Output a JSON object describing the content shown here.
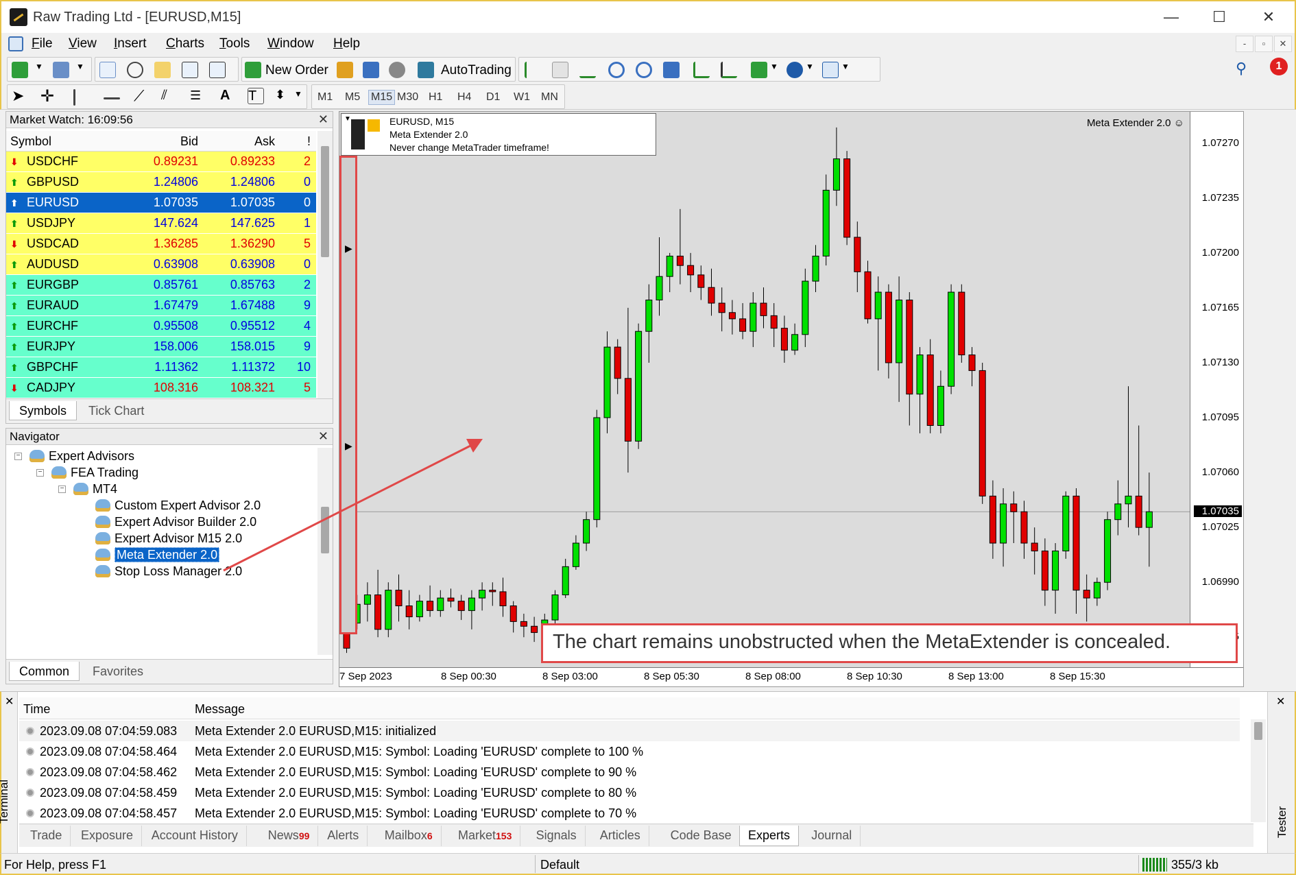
{
  "window": {
    "title": "Raw Trading Ltd - [EURUSD,M15]",
    "minimize": "—",
    "maximize": "☐",
    "close": "✕"
  },
  "menu": [
    "File",
    "View",
    "Insert",
    "Charts",
    "Tools",
    "Window",
    "Help"
  ],
  "mdi": [
    "-",
    "▫",
    "✕"
  ],
  "toolbar": {
    "new_order": "New Order",
    "autotrading": "AutoTrading",
    "notification_count": "1",
    "timeframes": [
      "M1",
      "M5",
      "M15",
      "M30",
      "H1",
      "H4",
      "D1",
      "W1",
      "MN"
    ],
    "selected_timeframe": "M15"
  },
  "market_watch": {
    "title": "Market Watch: 16:09:56",
    "columns": [
      "Symbol",
      "Bid",
      "Ask",
      "!"
    ],
    "rows": [
      {
        "symbol": "USDCHF",
        "bid": "0.89231",
        "ask": "0.89233",
        "count": "2",
        "dir": "down",
        "bg": "yellow"
      },
      {
        "symbol": "GBPUSD",
        "bid": "1.24806",
        "ask": "1.24806",
        "count": "0",
        "dir": "up",
        "bg": "yellow"
      },
      {
        "symbol": "EURUSD",
        "bid": "1.07035",
        "ask": "1.07035",
        "count": "0",
        "dir": "up",
        "bg": "selected"
      },
      {
        "symbol": "USDJPY",
        "bid": "147.624",
        "ask": "147.625",
        "count": "1",
        "dir": "up",
        "bg": "yellow"
      },
      {
        "symbol": "USDCAD",
        "bid": "1.36285",
        "ask": "1.36290",
        "count": "5",
        "dir": "down",
        "bg": "yellow"
      },
      {
        "symbol": "AUDUSD",
        "bid": "0.63908",
        "ask": "0.63908",
        "count": "0",
        "dir": "up",
        "bg": "yellow"
      },
      {
        "symbol": "EURGBP",
        "bid": "0.85761",
        "ask": "0.85763",
        "count": "2",
        "dir": "up",
        "bg": "cyan"
      },
      {
        "symbol": "EURAUD",
        "bid": "1.67479",
        "ask": "1.67488",
        "count": "9",
        "dir": "up",
        "bg": "cyan"
      },
      {
        "symbol": "EURCHF",
        "bid": "0.95508",
        "ask": "0.95512",
        "count": "4",
        "dir": "up",
        "bg": "cyan"
      },
      {
        "symbol": "EURJPY",
        "bid": "158.006",
        "ask": "158.015",
        "count": "9",
        "dir": "up",
        "bg": "cyan"
      },
      {
        "symbol": "GBPCHF",
        "bid": "1.11362",
        "ask": "1.11372",
        "count": "10",
        "dir": "up",
        "bg": "cyan"
      },
      {
        "symbol": "CADJPY",
        "bid": "108.316",
        "ask": "108.321",
        "count": "5",
        "dir": "down",
        "bg": "cyan"
      }
    ],
    "tabs": [
      "Symbols",
      "Tick Chart"
    ]
  },
  "navigator": {
    "title": "Navigator",
    "nodes": [
      "Expert Advisors",
      "FEA Trading",
      "MT4",
      "Custom Expert Advisor 2.0",
      "Expert Advisor Builder 2.0",
      "Expert Advisor M15 2.0",
      "Meta Extender 2.0",
      "Stop Loss Manager 2.0"
    ],
    "selected": "Meta Extender 2.0",
    "tabs": [
      "Common",
      "Favorites"
    ]
  },
  "chart": {
    "info_lines": [
      "EURUSD, M15",
      "Meta Extender 2.0",
      "Never change MetaTrader timeframe!"
    ],
    "ea_label": "Meta Extender 2.0 ☺",
    "callout": "The chart remains unobstructed when the MetaExtender is concealed.",
    "price_ticks": [
      "1.07270",
      "1.07235",
      "1.07200",
      "1.07165",
      "1.07130",
      "1.07095",
      "1.07060",
      "1.07025",
      "1.06990",
      "1.06955"
    ],
    "current_price": "1.07035",
    "time_ticks": [
      "7 Sep 2023",
      "8 Sep 00:30",
      "8 Sep 03:00",
      "8 Sep 05:30",
      "8 Sep 08:00",
      "8 Sep 10:30",
      "8 Sep 13:00",
      "8 Sep 15:30"
    ]
  },
  "chart_data": {
    "type": "candlestick",
    "symbol": "EURUSD",
    "timeframe": "M15",
    "ylim": [
      1.06935,
      1.0729
    ],
    "x_tick_labels": [
      "7 Sep 2023",
      "8 Sep 00:30",
      "8 Sep 03:00",
      "8 Sep 05:30",
      "8 Sep 08:00",
      "8 Sep 10:30",
      "8 Sep 13:00",
      "8 Sep 15:30"
    ],
    "y_tick_labels": [
      "1.07270",
      "1.07235",
      "1.07200",
      "1.07165",
      "1.07130",
      "1.07095",
      "1.07060",
      "1.07025",
      "1.06990",
      "1.06955"
    ],
    "last_price": 1.07035,
    "candles": [
      [
        1.06962,
        1.06973,
        1.06945,
        1.06948
      ],
      [
        1.06964,
        1.06982,
        1.0696,
        1.06976
      ],
      [
        1.06976,
        1.0699,
        1.06965,
        1.06982
      ],
      [
        1.06982,
        1.06998,
        1.06955,
        1.0696
      ],
      [
        1.0696,
        1.0699,
        1.06955,
        1.06985
      ],
      [
        1.06985,
        1.06995,
        1.06965,
        1.06975
      ],
      [
        1.06975,
        1.06985,
        1.0696,
        1.06968
      ],
      [
        1.06968,
        1.06982,
        1.06965,
        1.06978
      ],
      [
        1.06978,
        1.06988,
        1.06968,
        1.06972
      ],
      [
        1.06972,
        1.06985,
        1.06968,
        1.0698
      ],
      [
        1.0698,
        1.06986,
        1.06974,
        1.06978
      ],
      [
        1.06978,
        1.06982,
        1.06966,
        1.06972
      ],
      [
        1.06972,
        1.06985,
        1.0696,
        1.0698
      ],
      [
        1.0698,
        1.0699,
        1.06972,
        1.06985
      ],
      [
        1.06985,
        1.0699,
        1.06975,
        1.06984
      ],
      [
        1.06984,
        1.06993,
        1.06968,
        1.06975
      ],
      [
        1.06975,
        1.06978,
        1.06958,
        1.06965
      ],
      [
        1.06965,
        1.0697,
        1.06955,
        1.06962
      ],
      [
        1.06962,
        1.06968,
        1.06952,
        1.06958
      ],
      [
        1.06958,
        1.0697,
        1.06955,
        1.06966
      ],
      [
        1.06966,
        1.06985,
        1.0696,
        1.06982
      ],
      [
        1.06982,
        1.07005,
        1.0698,
        1.07
      ],
      [
        1.07,
        1.0702,
        1.06998,
        1.07015
      ],
      [
        1.07015,
        1.07035,
        1.0701,
        1.0703
      ],
      [
        1.0703,
        1.071,
        1.07025,
        1.07095
      ],
      [
        1.07095,
        1.0715,
        1.07085,
        1.0714
      ],
      [
        1.0714,
        1.07145,
        1.0711,
        1.0712
      ],
      [
        1.0712,
        1.07165,
        1.0706,
        1.0708
      ],
      [
        1.0708,
        1.07155,
        1.07075,
        1.0715
      ],
      [
        1.0715,
        1.0718,
        1.0713,
        1.0717
      ],
      [
        1.0717,
        1.0721,
        1.0716,
        1.07185
      ],
      [
        1.07185,
        1.072,
        1.07175,
        1.07198
      ],
      [
        1.07198,
        1.07228,
        1.0718,
        1.07192
      ],
      [
        1.07192,
        1.072,
        1.07175,
        1.07186
      ],
      [
        1.07186,
        1.07192,
        1.0717,
        1.07178
      ],
      [
        1.07178,
        1.0719,
        1.0716,
        1.07168
      ],
      [
        1.07168,
        1.07178,
        1.0715,
        1.07162
      ],
      [
        1.07162,
        1.0717,
        1.07148,
        1.07158
      ],
      [
        1.07158,
        1.07168,
        1.07145,
        1.0715
      ],
      [
        1.0715,
        1.07175,
        1.0714,
        1.07168
      ],
      [
        1.07168,
        1.07178,
        1.07152,
        1.0716
      ],
      [
        1.0716,
        1.07168,
        1.0714,
        1.07152
      ],
      [
        1.07152,
        1.0716,
        1.0713,
        1.07138
      ],
      [
        1.07138,
        1.07155,
        1.07135,
        1.07148
      ],
      [
        1.07148,
        1.0719,
        1.0714,
        1.07182
      ],
      [
        1.07182,
        1.07205,
        1.07175,
        1.07198
      ],
      [
        1.07198,
        1.0725,
        1.07192,
        1.0724
      ],
      [
        1.0724,
        1.0728,
        1.0723,
        1.0726
      ],
      [
        1.0726,
        1.07265,
        1.07205,
        1.0721
      ],
      [
        1.0721,
        1.0722,
        1.07175,
        1.07188
      ],
      [
        1.07188,
        1.07195,
        1.07155,
        1.07158
      ],
      [
        1.07158,
        1.07185,
        1.07125,
        1.07175
      ],
      [
        1.07175,
        1.0718,
        1.0712,
        1.0713
      ],
      [
        1.0713,
        1.07185,
        1.07105,
        1.0717
      ],
      [
        1.0717,
        1.07175,
        1.0709,
        1.0711
      ],
      [
        1.0711,
        1.0714,
        1.07085,
        1.07135
      ],
      [
        1.07135,
        1.07145,
        1.07085,
        1.0709
      ],
      [
        1.0709,
        1.07125,
        1.07085,
        1.07115
      ],
      [
        1.07115,
        1.0718,
        1.0711,
        1.07175
      ],
      [
        1.07175,
        1.0718,
        1.0713,
        1.07135
      ],
      [
        1.07135,
        1.0714,
        1.07115,
        1.07125
      ],
      [
        1.07125,
        1.0713,
        1.0704,
        1.07045
      ],
      [
        1.07045,
        1.07055,
        1.07005,
        1.07015
      ],
      [
        1.07015,
        1.0705,
        1.07,
        1.0704
      ],
      [
        1.0704,
        1.07048,
        1.07015,
        1.07035
      ],
      [
        1.07035,
        1.07042,
        1.07005,
        1.07015
      ],
      [
        1.07015,
        1.07025,
        1.06995,
        1.0701
      ],
      [
        1.0701,
        1.07018,
        1.06975,
        1.06985
      ],
      [
        1.06985,
        1.07015,
        1.0697,
        1.0701
      ],
      [
        1.0701,
        1.07048,
        1.07005,
        1.07045
      ],
      [
        1.07045,
        1.0705,
        1.0697,
        1.06985
      ],
      [
        1.06985,
        1.06995,
        1.06965,
        1.0698
      ],
      [
        1.0698,
        1.06993,
        1.06975,
        1.0699
      ],
      [
        1.0699,
        1.07035,
        1.06985,
        1.0703
      ],
      [
        1.0703,
        1.07055,
        1.0702,
        1.0704
      ],
      [
        1.0704,
        1.07115,
        1.07025,
        1.07045
      ],
      [
        1.07045,
        1.0709,
        1.0702,
        1.07025
      ],
      [
        1.07025,
        1.0706,
        1.07,
        1.07035
      ]
    ]
  },
  "terminal": {
    "columns": [
      "Time",
      "Message"
    ],
    "rows": [
      {
        "time": "2023.09.08 07:04:59.083",
        "message": "Meta Extender 2.0 EURUSD,M15: initialized"
      },
      {
        "time": "2023.09.08 07:04:58.464",
        "message": "Meta Extender 2.0 EURUSD,M15: Symbol: Loading 'EURUSD' complete to 100 %"
      },
      {
        "time": "2023.09.08 07:04:58.462",
        "message": "Meta Extender 2.0 EURUSD,M15: Symbol: Loading 'EURUSD' complete to 90 %"
      },
      {
        "time": "2023.09.08 07:04:58.459",
        "message": "Meta Extender 2.0 EURUSD,M15: Symbol: Loading 'EURUSD' complete to 80 %"
      },
      {
        "time": "2023.09.08 07:04:58.457",
        "message": "Meta Extender 2.0 EURUSD,M15: Symbol: Loading 'EURUSD' complete to 70 %"
      }
    ],
    "tabs": [
      {
        "label": "Trade",
        "badge": ""
      },
      {
        "label": "Exposure",
        "badge": ""
      },
      {
        "label": "Account History",
        "badge": ""
      },
      {
        "label": "News",
        "badge": "99"
      },
      {
        "label": "Alerts",
        "badge": ""
      },
      {
        "label": "Mailbox",
        "badge": "6"
      },
      {
        "label": "Market",
        "badge": "153"
      },
      {
        "label": "Signals",
        "badge": ""
      },
      {
        "label": "Articles",
        "badge": ""
      },
      {
        "label": "Code Base",
        "badge": ""
      },
      {
        "label": "Experts",
        "badge": ""
      },
      {
        "label": "Journal",
        "badge": ""
      }
    ],
    "active_tab": "Experts",
    "side_label": "Terminal",
    "tester_label": "Tester"
  },
  "statusbar": {
    "help": "For Help, press F1",
    "profile": "Default",
    "traffic": "355/3 kb"
  },
  "colors": {
    "bull": "#00e000",
    "bear": "#e00000",
    "chart_bg": "#dcdcdc",
    "selection": "#0a64c8",
    "callout_border": "#e04848",
    "window_border": "#e8c44a"
  }
}
